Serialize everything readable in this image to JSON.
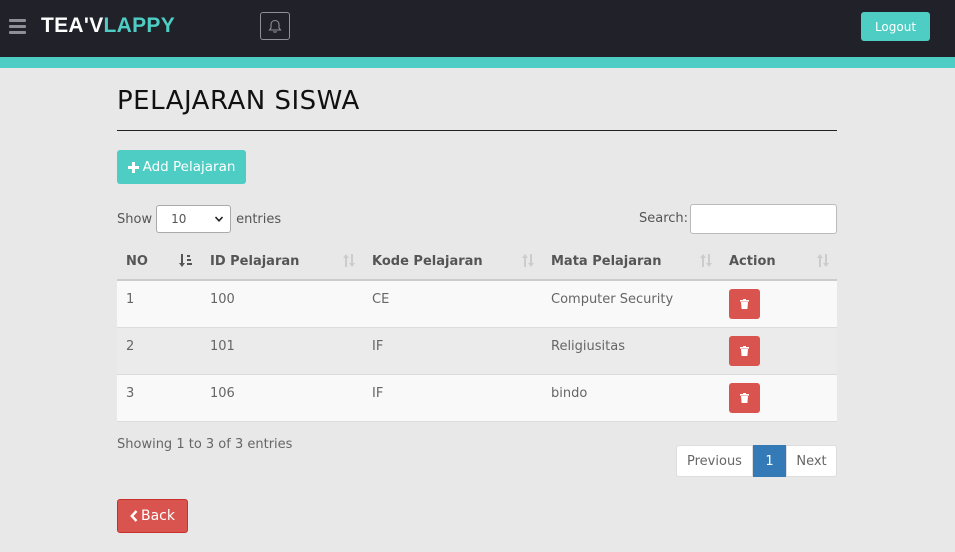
{
  "header": {
    "brand_part1": "TEA'V",
    "brand_part2": "LAPPY",
    "logout_label": "Logout",
    "menu_icon": "hamburger-icon",
    "notification_icon": "bell-icon"
  },
  "colors": {
    "accent": "#4ecdc4",
    "navbar": "#212229",
    "danger": "#d9534f",
    "primary": "#337ab7"
  },
  "page": {
    "title": "PELAJARAN SISWA",
    "add_label": "Add Pelajaran",
    "back_label": "Back"
  },
  "controls": {
    "show_label": "Show",
    "entries_label": "entries",
    "length_value": "10",
    "search_label": "Search:",
    "search_value": ""
  },
  "table": {
    "columns": [
      "NO",
      "ID Pelajaran",
      "Kode Pelajaran",
      "Mata Pelajaran",
      "Action"
    ],
    "rows": [
      {
        "no": "1",
        "id": "100",
        "kode": "CE",
        "mata": "Computer Security"
      },
      {
        "no": "2",
        "id": "101",
        "kode": "IF",
        "mata": "Religiusitas"
      },
      {
        "no": "3",
        "id": "106",
        "kode": "IF",
        "mata": "bindo"
      }
    ]
  },
  "footer": {
    "info": "Showing 1 to 3 of 3 entries",
    "previous_label": "Previous",
    "current_page": "1",
    "next_label": "Next"
  }
}
